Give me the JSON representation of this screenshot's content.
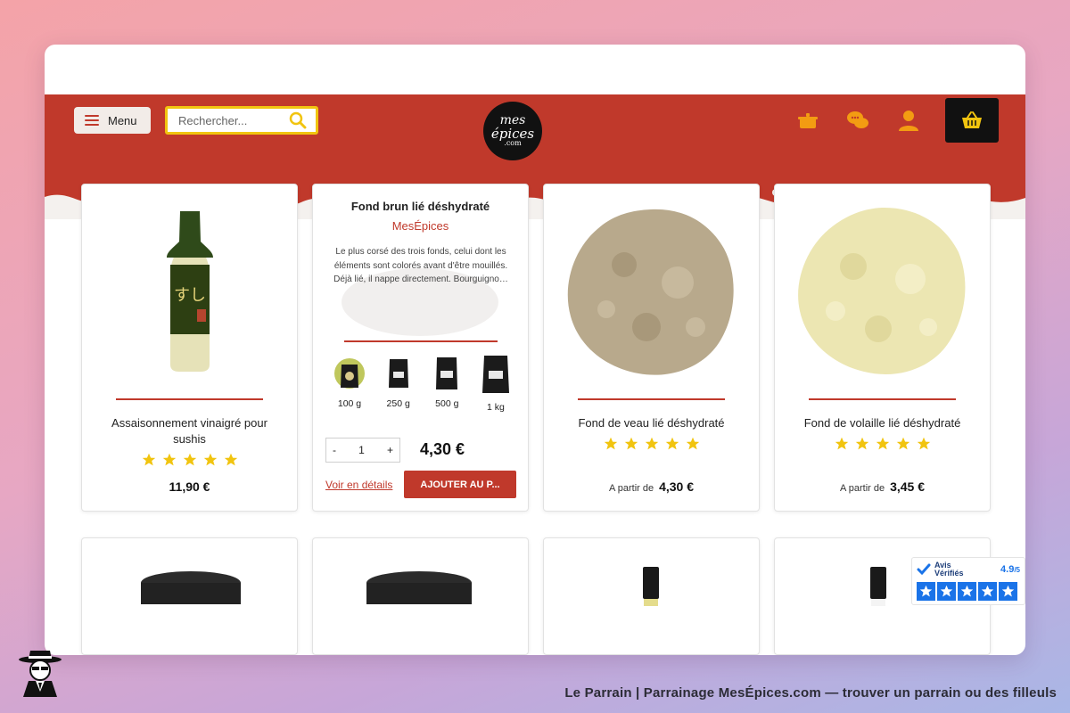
{
  "header": {
    "menu_label": "Menu",
    "search_placeholder": "Rechercher...",
    "logo": {
      "line1": "mes",
      "line2": "épices",
      "line3": ".com"
    }
  },
  "colors": {
    "brand_red": "#c0392b",
    "star_yellow": "#f1c40f",
    "badge_blue": "#1a73e8"
  },
  "icons": [
    "burger-menu-icon",
    "search-icon",
    "cooking-pot-icon",
    "chat-bubbles-icon",
    "user-icon",
    "basket-icon"
  ],
  "products": [
    {
      "title": "Assaisonnement vinaigré pour sushis",
      "rating": 5,
      "price": "11,90 €"
    },
    {
      "title": "Fond brun lié déshydraté",
      "brand": "MesÉpices",
      "description": "Le plus corsé des trois fonds, celui dont les éléments sont colorés avant d'être mouillés. Déjà lié, il nappe directement. Bourguigno…",
      "variants": [
        {
          "label": "100 g"
        },
        {
          "label": "250 g"
        },
        {
          "label": "500 g"
        },
        {
          "label": "1 kg"
        }
      ],
      "quantity": {
        "minus": "-",
        "value": "1",
        "plus": "+"
      },
      "price": "4,30 €",
      "details_link": "Voir en détails",
      "add_button": "AJOUTER AU P..."
    },
    {
      "title": "Fond de veau lié déshydraté",
      "rating": 5,
      "price_prefix": "A partir de",
      "price": "4,30 €"
    },
    {
      "title": "Fond de volaille lié déshydraté",
      "rating": 5,
      "price_prefix": "A partir de",
      "price": "3,45 €"
    }
  ],
  "reviews_badge": {
    "name_line1": "Avis",
    "name_line2": "Vérifiés",
    "score": "4.9",
    "score_suffix": "/5",
    "stars": 5
  },
  "footer": {
    "caption": "Le Parrain | Parrainage MesÉpices.com — trouver un parrain ou des filleuls"
  }
}
